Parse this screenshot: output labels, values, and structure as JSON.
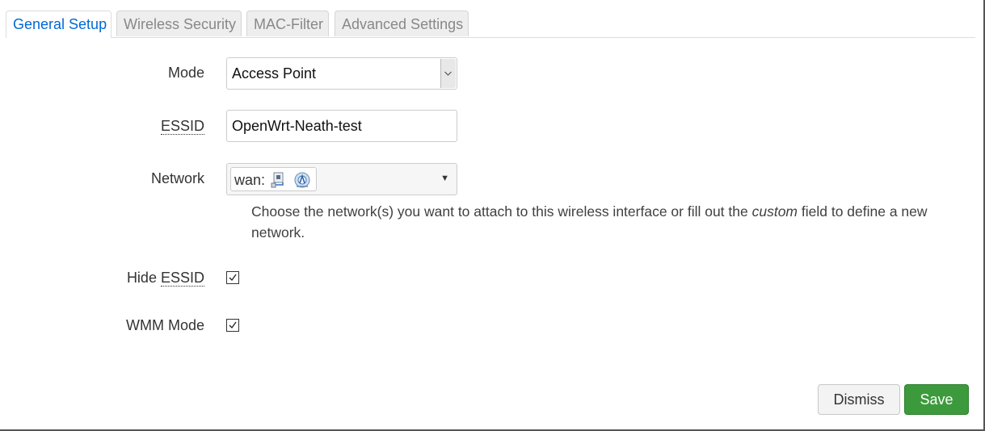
{
  "tabs": [
    {
      "label": "General Setup",
      "active": true
    },
    {
      "label": "Wireless Security",
      "active": false
    },
    {
      "label": "MAC-Filter",
      "active": false
    },
    {
      "label": "Advanced Settings",
      "active": false
    }
  ],
  "form": {
    "mode": {
      "label": "Mode",
      "value": "Access Point"
    },
    "essid": {
      "label": "ESSID",
      "value": "OpenWrt-Neath-test"
    },
    "network": {
      "label": "Network",
      "chip_label": "wan:",
      "chip_icons": [
        "ethernet-port-icon",
        "wireless-network-icon"
      ],
      "help_before": "Choose the network(s) you want to attach to this wireless interface or fill out the ",
      "help_emphasis": "custom",
      "help_after": " field to define a new network."
    },
    "hide_essid": {
      "label_prefix": "Hide ",
      "label_abbr": "ESSID",
      "checked": true
    },
    "wmm_mode": {
      "label": "WMM Mode",
      "checked": true
    }
  },
  "buttons": {
    "dismiss": "Dismiss",
    "save": "Save"
  },
  "colors": {
    "active_tab": "#0069d6",
    "save_button": "#3c9a3c"
  }
}
